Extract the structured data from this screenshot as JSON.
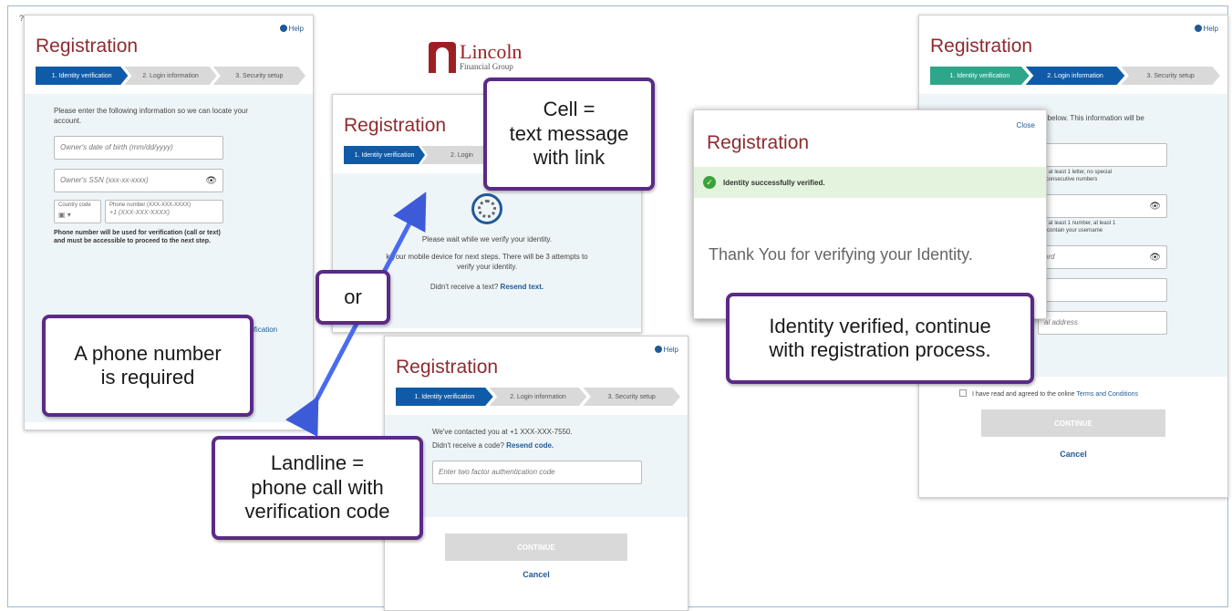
{
  "card1": {
    "title": "Registration",
    "help": "Help",
    "steps": [
      "1. Identity verification",
      "2. Login information",
      "3. Security setup"
    ],
    "instructions": "Please enter the following information so we can locate your account.",
    "dob_placeholder": "Owner's date of birth (mm/dd/yyyy)",
    "ssn_placeholder": "Owner's SSN (xxx-xx-xxxx)",
    "country_label": "Country code",
    "phone_label": "Phone number (XXX-XXX-XXXX)",
    "phone_placeholder": "+1 (XXX-XXX-XXXX)",
    "phone_note": "Phone number will be used for verification (call or text) and must be accessible to proceed to the next step.",
    "link_fragment": "ification"
  },
  "logo": {
    "name": "Lincoln",
    "sub": "Financial Group"
  },
  "card2": {
    "title": "Registration",
    "step1": "1. Identity verification",
    "step2": "2. Login",
    "wait": "Please wait while we verify your identity.",
    "device": "k your mobile device for next steps. There will be 3 attempts to verify your identity.",
    "no_text": "Didn't receive a text?",
    "resend_text": "Resend text."
  },
  "card3": {
    "title": "Registration",
    "help": "Help",
    "steps": [
      "1. Identity verification",
      "2. Login information",
      "3. Security setup"
    ],
    "contacted": "We've contacted you at +1 XXX-XXX-7550.",
    "no_code": "Didn't receive a code?",
    "resend_code": "Resend code.",
    "code_placeholder": "Enter two factor authentication code",
    "continue": "CONTINUE",
    "cancel": "Cancel"
  },
  "card4": {
    "title": "Registration",
    "close": "Close",
    "success": "Identity successfully verified.",
    "thanks": "Thank You for verifying your Identity."
  },
  "card5": {
    "title": "Registration",
    "help": "Help",
    "steps": [
      "1. Identity verification",
      "2. Login information",
      "3. Security setup"
    ],
    "intro": "ds below. This information will be",
    "intro2": "s.",
    "rule1": "ers, at least 1 letter, no special",
    "rule1b": "r 3 consecutive numbers",
    "rule2": "ers, at least 1 number, at least 1",
    "rule2b": "not contain your username",
    "field3": "ord",
    "field5": "al address",
    "terms_text": "I have read and agreed to the online",
    "terms_link": "Terms and Conditions",
    "continue": "CONTINUE",
    "cancel": "Cancel"
  },
  "callouts": {
    "cell": "Cell =\ntext message\nwith link",
    "or": "or",
    "phone_required": "A phone number\nis required",
    "landline": "Landline =\nphone call with\nverification code",
    "verified": "Identity verified, continue\nwith registration process."
  }
}
